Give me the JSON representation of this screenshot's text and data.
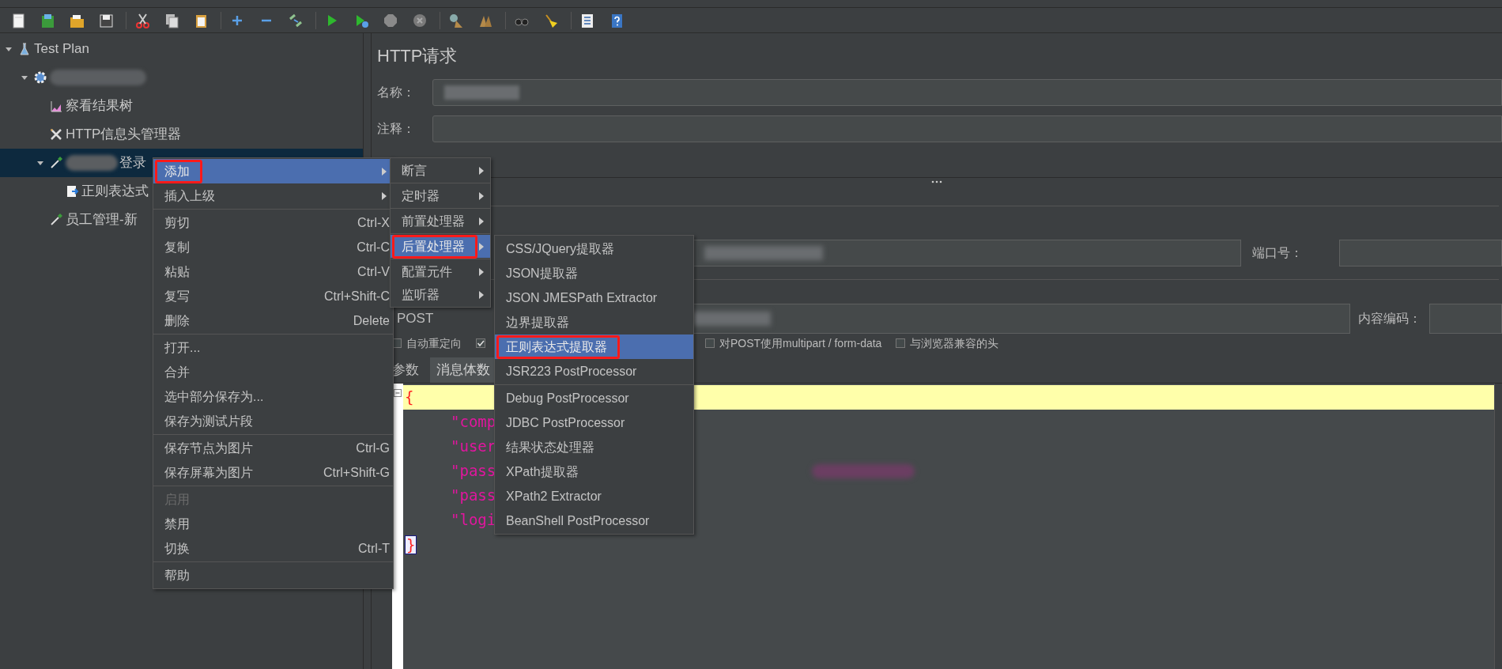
{
  "tree": [
    {
      "label": "Test Plan",
      "kind": "plan",
      "expanded": true,
      "selected": false,
      "redacted": false,
      "children": [
        {
          "kind": "thread_group",
          "expanded": true,
          "selected": false,
          "redacted": true,
          "children": [
            {
              "label": "察看结果树",
              "kind": "listener",
              "selected": false,
              "redacted": false
            },
            {
              "label": "HTTP信息头管理器",
              "kind": "config",
              "selected": false,
              "redacted": false
            },
            {
              "label": "登录",
              "kind": "sampler",
              "expanded": true,
              "selected": true,
              "redacted": true,
              "children": [
                {
                  "label": "正则表达式",
                  "kind": "extractor",
                  "selected": false,
                  "redacted": false
                }
              ]
            },
            {
              "label": "员工管理-新",
              "kind": "sampler",
              "selected": false,
              "redacted": false
            }
          ]
        }
      ]
    }
  ],
  "panel": {
    "title": "HTTP请求",
    "name_label": "名称：",
    "comment_label": "注释：",
    "port_label": "端口号：",
    "encoding_label": "内容编码：",
    "method": "POST",
    "options": [
      {
        "label": "自动重定向",
        "checked": false
      },
      {
        "checked": true
      },
      {
        "label": "对POST使用multipart / form-data",
        "checked": false
      },
      {
        "label": "与浏览器兼容的头",
        "checked": false
      }
    ],
    "tabs": [
      {
        "label": "参数",
        "selected": false
      },
      {
        "label": "消息体数",
        "selected": true
      }
    ],
    "editor_lines": [
      {
        "text": "{",
        "kind": "brace",
        "current": true,
        "redacted": false
      },
      {
        "text": "\"comp",
        "kind": "key",
        "current": false,
        "redacted": false
      },
      {
        "text": "\"user",
        "kind": "key",
        "current": false,
        "redacted": false
      },
      {
        "text": "\"pass",
        "kind": "key",
        "current": false,
        "redacted": true
      },
      {
        "text": "\"pass",
        "kind": "key",
        "current": false,
        "redacted": false
      },
      {
        "text": "\"logi",
        "kind": "key",
        "current": false,
        "redacted": false
      },
      {
        "text": "}",
        "kind": "brace",
        "current": false,
        "redacted": false
      }
    ]
  },
  "context_menu": {
    "groups": [
      [
        {
          "label": "添加",
          "submenu": true,
          "selected": true,
          "disabled": false,
          "highlighted": true
        },
        {
          "label": "插入上级",
          "submenu": true,
          "selected": false,
          "disabled": false,
          "highlighted": false
        }
      ],
      [
        {
          "label": "剪切",
          "shortcut": "Ctrl-X",
          "submenu": false,
          "selected": false,
          "disabled": false,
          "highlighted": false
        },
        {
          "label": "复制",
          "shortcut": "Ctrl-C",
          "submenu": false,
          "selected": false,
          "disabled": false,
          "highlighted": false
        },
        {
          "label": "粘贴",
          "shortcut": "Ctrl-V",
          "submenu": false,
          "selected": false,
          "disabled": false,
          "highlighted": false
        },
        {
          "label": "复写",
          "shortcut": "Ctrl+Shift-C",
          "submenu": false,
          "selected": false,
          "disabled": false,
          "highlighted": false
        },
        {
          "label": "删除",
          "shortcut": "Delete",
          "submenu": false,
          "selected": false,
          "disabled": false,
          "highlighted": false
        }
      ],
      [
        {
          "label": "打开...",
          "submenu": false,
          "selected": false,
          "disabled": false,
          "highlighted": false
        },
        {
          "label": "合并",
          "submenu": false,
          "selected": false,
          "disabled": false,
          "highlighted": false
        },
        {
          "label": "选中部分保存为...",
          "submenu": false,
          "selected": false,
          "disabled": false,
          "highlighted": false
        },
        {
          "label": "保存为测试片段",
          "submenu": false,
          "selected": false,
          "disabled": false,
          "highlighted": false
        }
      ],
      [
        {
          "label": "保存节点为图片",
          "shortcut": "Ctrl-G",
          "submenu": false,
          "selected": false,
          "disabled": false,
          "highlighted": false
        },
        {
          "label": "保存屏幕为图片",
          "shortcut": "Ctrl+Shift-G",
          "submenu": false,
          "selected": false,
          "disabled": false,
          "highlighted": false
        }
      ],
      [
        {
          "label": "启用",
          "submenu": false,
          "selected": false,
          "disabled": true,
          "highlighted": false
        },
        {
          "label": "禁用",
          "submenu": false,
          "selected": false,
          "disabled": false,
          "highlighted": false
        },
        {
          "label": "切换",
          "shortcut": "Ctrl-T",
          "submenu": false,
          "selected": false,
          "disabled": false,
          "highlighted": false
        }
      ],
      [
        {
          "label": "帮助",
          "submenu": false,
          "selected": false,
          "disabled": false,
          "highlighted": false
        }
      ]
    ]
  },
  "add_submenu": {
    "groups": [
      [
        {
          "label": "断言",
          "submenu": true,
          "selected": false,
          "highlighted": false
        }
      ],
      [
        {
          "label": "定时器",
          "submenu": true,
          "selected": false,
          "highlighted": false
        }
      ],
      [
        {
          "label": "前置处理器",
          "submenu": true,
          "selected": false,
          "highlighted": false
        }
      ],
      [
        {
          "label": "后置处理器",
          "submenu": true,
          "selected": true,
          "highlighted": true
        }
      ],
      [
        {
          "label": "配置元件",
          "submenu": true,
          "selected": false,
          "highlighted": false
        },
        {
          "label": "监听器",
          "submenu": true,
          "selected": false,
          "highlighted": false
        }
      ]
    ]
  },
  "postprocessor_submenu": {
    "groups": [
      [
        {
          "label": "CSS/JQuery提取器",
          "submenu": false,
          "selected": false,
          "highlighted": false
        },
        {
          "label": "JSON提取器",
          "submenu": false,
          "selected": false,
          "highlighted": false
        },
        {
          "label": "JSON JMESPath Extractor",
          "submenu": false,
          "selected": false,
          "highlighted": false
        },
        {
          "label": "边界提取器",
          "submenu": false,
          "selected": false,
          "highlighted": false
        },
        {
          "label": "正则表达式提取器",
          "submenu": false,
          "selected": true,
          "highlighted": true
        },
        {
          "label": "JSR223 PostProcessor",
          "submenu": false,
          "selected": false,
          "highlighted": false
        }
      ],
      [
        {
          "label": "Debug PostProcessor",
          "submenu": false,
          "selected": false,
          "highlighted": false
        },
        {
          "label": "JDBC PostProcessor",
          "submenu": false,
          "selected": false,
          "highlighted": false
        },
        {
          "label": "结果状态处理器",
          "submenu": false,
          "selected": false,
          "highlighted": false
        },
        {
          "label": "XPath提取器",
          "submenu": false,
          "selected": false,
          "highlighted": false
        },
        {
          "label": "XPath2 Extractor",
          "submenu": false,
          "selected": false,
          "highlighted": false
        },
        {
          "label": "BeanShell PostProcessor",
          "submenu": false,
          "selected": false,
          "highlighted": false
        }
      ]
    ]
  }
}
